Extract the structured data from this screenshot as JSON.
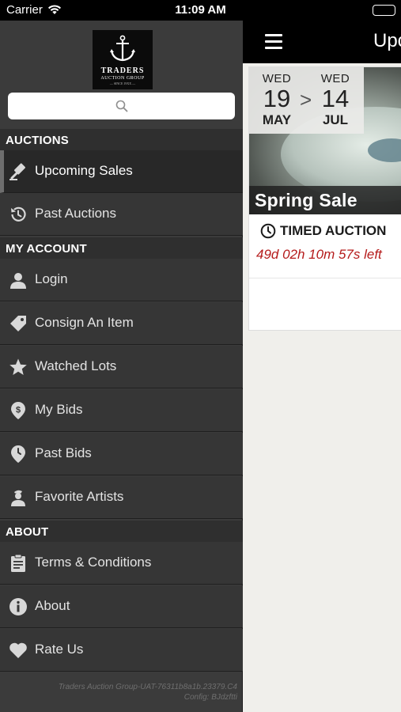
{
  "status_bar": {
    "carrier": "Carrier",
    "time": "11:09 AM"
  },
  "header": {
    "title": "Upcoming Sales",
    "menu_icon": "hamburger-icon"
  },
  "logo": {
    "line1": "TRADERS",
    "line2": "AUCTION GROUP",
    "line3": "— SINCE 19XX —"
  },
  "search": {
    "placeholder": "",
    "icon": "search-icon"
  },
  "sections": {
    "auctions": "AUCTIONS",
    "my_account": "MY ACCOUNT",
    "about": "ABOUT"
  },
  "menu": {
    "upcoming_sales": "Upcoming Sales",
    "past_auctions": "Past Auctions",
    "login": "Login",
    "consign": "Consign An Item",
    "watched": "Watched Lots",
    "my_bids": "My Bids",
    "past_bids": "Past Bids",
    "favorite_artists": "Favorite Artists",
    "terms": "Terms & Conditions",
    "about": "About",
    "rate_us": "Rate Us"
  },
  "footer": {
    "version": "Traders Auction Group-UAT-76311b8a1b.23379.C4",
    "config": "Config: BJdzftti"
  },
  "sale": {
    "start_dow": "WED",
    "start_day": "19",
    "start_month": "MAY",
    "separator": ">",
    "end_dow": "WED",
    "end_day": "14",
    "end_month": "JUL",
    "name": "Spring Sale",
    "type": "TIMED AUCTION",
    "countdown": "49d 02h 10m 57s left"
  },
  "colors": {
    "drawer_bg": "#3b3b3b",
    "section_bg": "#2f2f2f",
    "countdown": "#b51b1b",
    "topbar": "#000000"
  }
}
